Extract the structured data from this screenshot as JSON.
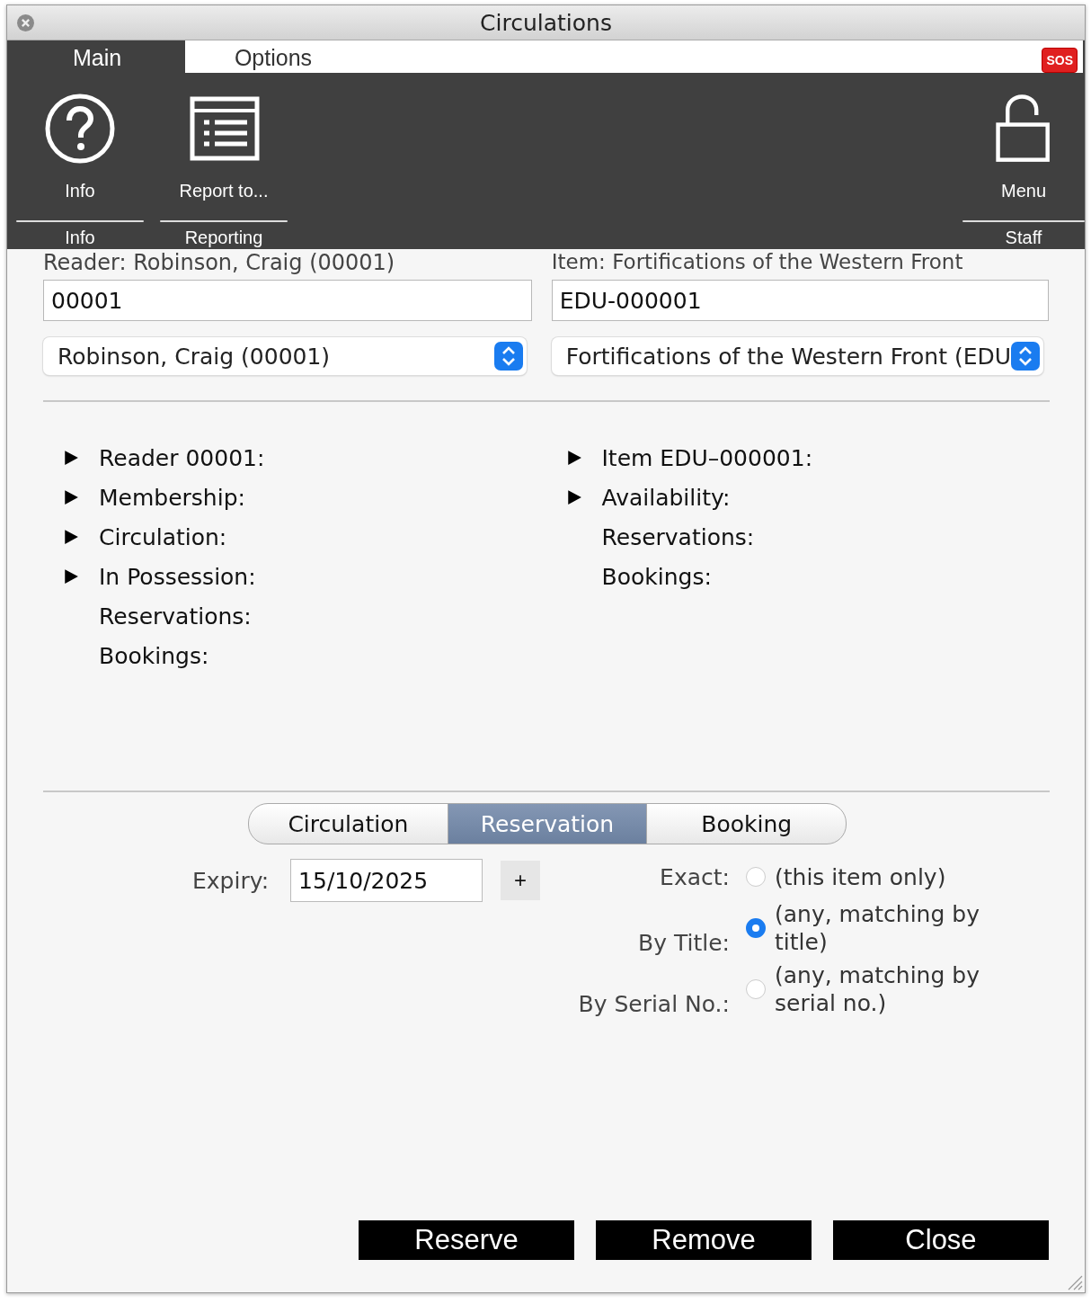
{
  "window": {
    "title": "Circulations"
  },
  "tabs": [
    {
      "label": "Main",
      "selected": true
    },
    {
      "label": "Options",
      "selected": false
    }
  ],
  "sos": "SOS",
  "toolbar": {
    "groups": [
      {
        "label": "Info",
        "buttons": [
          {
            "label": "Info"
          }
        ]
      },
      {
        "label": "Reporting",
        "buttons": [
          {
            "label": "Report to..."
          }
        ]
      },
      {
        "label": "Staff",
        "buttons": [
          {
            "label": "Menu"
          }
        ]
      }
    ]
  },
  "reader": {
    "label": "Reader: Robinson, Craig (00001)",
    "value": "00001",
    "select": "Robinson, Craig (00001)"
  },
  "item": {
    "label": "Item: Fortifications of the Western Front",
    "value": "EDU-000001",
    "select": "Fortifications of the Western Front (EDU"
  },
  "reader_details": [
    {
      "label": "Reader 00001:",
      "expandable": true
    },
    {
      "label": "Membership:",
      "expandable": true
    },
    {
      "label": "Circulation:",
      "expandable": true
    },
    {
      "label": "In Possession:",
      "expandable": true
    },
    {
      "label": "Reservations:",
      "expandable": false
    },
    {
      "label": "Bookings:",
      "expandable": false
    }
  ],
  "item_details": [
    {
      "label": "Item EDU–000001:",
      "expandable": true
    },
    {
      "label": "Availability:",
      "expandable": true
    },
    {
      "label": "Reservations:",
      "expandable": false
    },
    {
      "label": "Bookings:",
      "expandable": false
    }
  ],
  "mode_tabs": [
    {
      "label": "Circulation",
      "selected": false
    },
    {
      "label": "Reservation",
      "selected": true
    },
    {
      "label": "Booking",
      "selected": false
    }
  ],
  "expiry": {
    "label": "Expiry:",
    "value": "15/10/2025",
    "button": "+"
  },
  "match_options": [
    {
      "label": "Exact:",
      "text": "(this item only)",
      "selected": false
    },
    {
      "label": "By Title:",
      "text": "(any, matching by title)",
      "selected": true
    },
    {
      "label": "By Serial No.:",
      "text": "(any, matching by serial no.)",
      "selected": false
    }
  ],
  "buttons": [
    "Reserve",
    "Remove",
    "Close"
  ]
}
